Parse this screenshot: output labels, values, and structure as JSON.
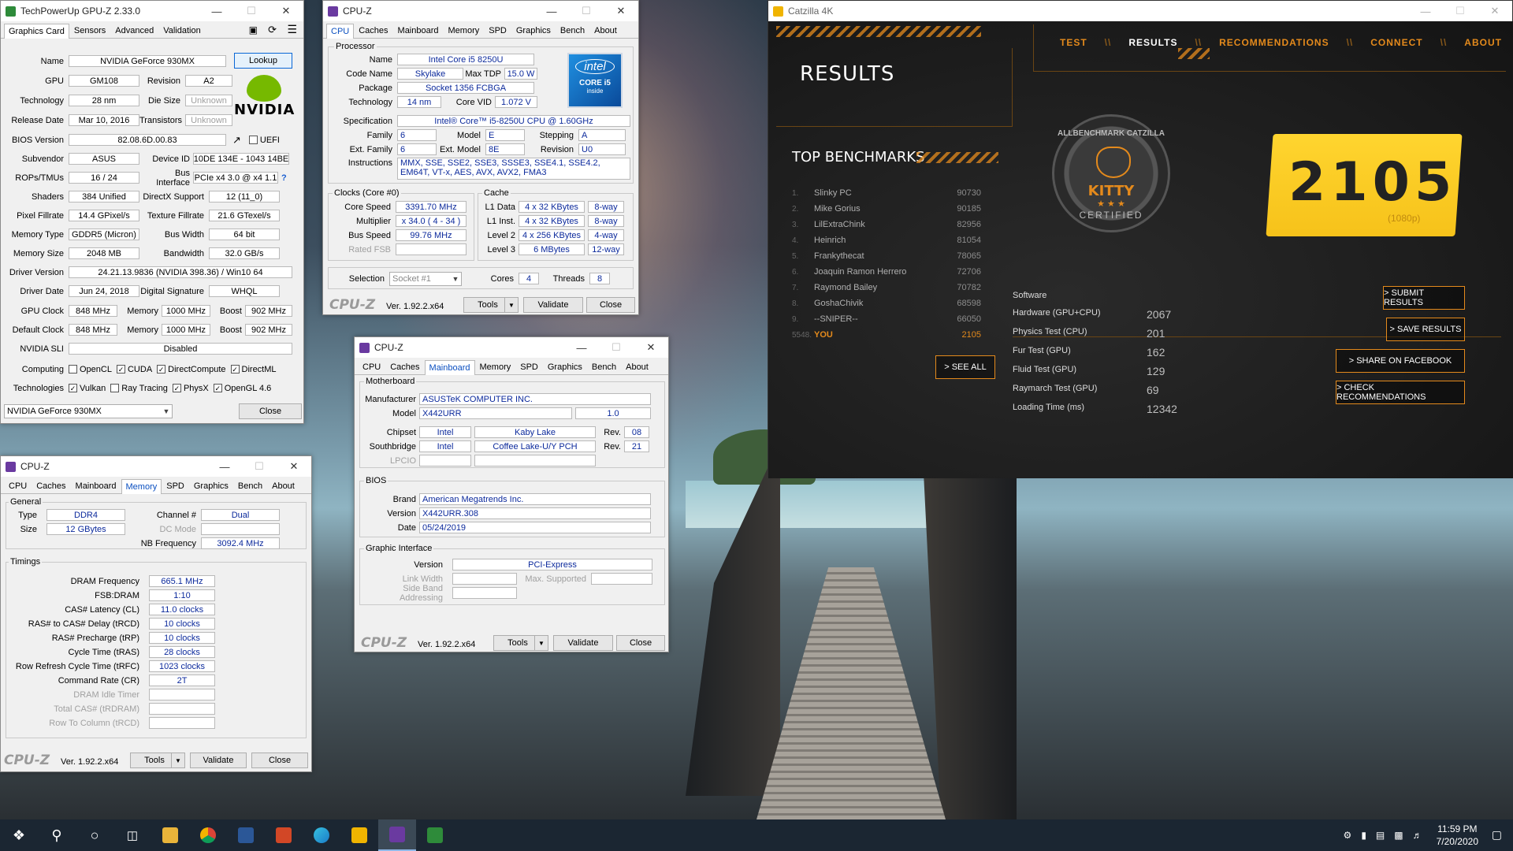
{
  "gpuz": {
    "title": "TechPowerUp GPU-Z 2.33.0",
    "tabs": [
      "Graphics Card",
      "Sensors",
      "Advanced",
      "Validation"
    ],
    "lookup": "Lookup",
    "name_l": "Name",
    "name": "NVIDIA GeForce 930MX",
    "gpu_l": "GPU",
    "gpu": "GM108",
    "rev_l": "Revision",
    "rev": "A2",
    "tech_l": "Technology",
    "tech": "28 nm",
    "die_l": "Die Size",
    "die": "Unknown",
    "rel_l": "Release Date",
    "rel": "Mar 10, 2016",
    "trans_l": "Transistors",
    "trans": "Unknown",
    "bios_l": "BIOS Version",
    "bios": "82.08.6D.00.83",
    "uefi": "UEFI",
    "sub_l": "Subvendor",
    "sub": "ASUS",
    "devid_l": "Device ID",
    "devid": "10DE 134E - 1043 14BE",
    "rops_l": "ROPs/TMUs",
    "rops": "16 / 24",
    "bus_l": "Bus Interface",
    "bus": "PCIe x4 3.0 @ x4 1.1",
    "shad_l": "Shaders",
    "shad": "384 Unified",
    "dx_l": "DirectX Support",
    "dx": "12 (11_0)",
    "pix_l": "Pixel Fillrate",
    "pix": "14.4 GPixel/s",
    "tex_l": "Texture Fillrate",
    "tex": "21.6 GTexel/s",
    "mtype_l": "Memory Type",
    "mtype": "GDDR5 (Micron)",
    "bw_l": "Bus Width",
    "bw": "64 bit",
    "msize_l": "Memory Size",
    "msize": "2048 MB",
    "band_l": "Bandwidth",
    "band": "32.0 GB/s",
    "drv_l": "Driver Version",
    "drv": "24.21.13.9836 (NVIDIA 398.36) / Win10 64",
    "ddate_l": "Driver Date",
    "ddate": "Jun 24, 2018",
    "dsig_l": "Digital Signature",
    "dsig": "WHQL",
    "gclk_l": "GPU Clock",
    "gclk": "848 MHz",
    "mem_l": "Memory",
    "memclk": "1000 MHz",
    "boost_l": "Boost",
    "boost": "902 MHz",
    "dclk_l": "Default Clock",
    "dclk": "848 MHz",
    "dmem": "1000 MHz",
    "dboost": "902 MHz",
    "sli_l": "NVIDIA SLI",
    "sli": "Disabled",
    "comp_l": "Computing",
    "comp": [
      "OpenCL",
      "CUDA",
      "DirectCompute",
      "DirectML"
    ],
    "techs_l": "Technologies",
    "techs": [
      "Vulkan",
      "Ray Tracing",
      "PhysX",
      "OpenGL 4.6"
    ],
    "select": "NVIDIA GeForce 930MX",
    "close": "Close",
    "logo": "NVIDIA"
  },
  "cpuz_cpu": {
    "title": "CPU-Z",
    "tabs": [
      "CPU",
      "Caches",
      "Mainboard",
      "Memory",
      "SPD",
      "Graphics",
      "Bench",
      "About"
    ],
    "proc": "Processor",
    "name_l": "Name",
    "name": "Intel Core i5 8250U",
    "code_l": "Code Name",
    "code": "Skylake",
    "tdp_l": "Max TDP",
    "tdp": "15.0 W",
    "pkg_l": "Package",
    "pkg": "Socket 1356 FCBGA",
    "tech_l": "Technology",
    "tech": "14 nm",
    "vid_l": "Core VID",
    "vid": "1.072 V",
    "spec_l": "Specification",
    "spec": "Intel® Core™ i5-8250U CPU @ 1.60GHz",
    "fam_l": "Family",
    "fam": "6",
    "model_l": "Model",
    "model": "E",
    "step_l": "Stepping",
    "step": "A",
    "efam_l": "Ext. Family",
    "efam": "6",
    "emod_l": "Ext. Model",
    "emod": "8E",
    "rev_l": "Revision",
    "rev": "U0",
    "instr_l": "Instructions",
    "instr": "MMX, SSE, SSE2, SSE3, SSSE3, SSE4.1, SSE4.2, EM64T, VT-x, AES, AVX, AVX2, FMA3",
    "clocks": "Clocks (Core #0)",
    "cache": "Cache",
    "cs_l": "Core Speed",
    "cs": "3391.70 MHz",
    "mul_l": "Multiplier",
    "mul": "x 34.0 ( 4 - 34 )",
    "bs_l": "Bus Speed",
    "bs": "99.76 MHz",
    "fsb_l": "Rated FSB",
    "l1d_l": "L1 Data",
    "l1d": "4 x 32 KBytes",
    "l1d_w": "8-way",
    "l1i_l": "L1 Inst.",
    "l1i": "4 x 32 KBytes",
    "l1i_w": "8-way",
    "l2_l": "Level 2",
    "l2": "4 x 256 KBytes",
    "l2_w": "4-way",
    "l3_l": "Level 3",
    "l3": "6 MBytes",
    "l3_w": "12-way",
    "sel_l": "Selection",
    "sel": "Socket #1",
    "cores_l": "Cores",
    "cores": "4",
    "thr_l": "Threads",
    "thr": "8",
    "intel_a": "intel",
    "intel_b": "CORE i5",
    "intel_c": "inside"
  },
  "cpuz_common": {
    "logo": "CPU-Z",
    "ver": "Ver. 1.92.2.x64",
    "tools": "Tools",
    "validate": "Validate",
    "close": "Close"
  },
  "cpuz_mb": {
    "title": "CPU-Z",
    "mb": "Motherboard",
    "man_l": "Manufacturer",
    "man": "ASUSTeK COMPUTER INC.",
    "model_l": "Model",
    "model": "X442URR",
    "model_rev": "1.0",
    "chip_l": "Chipset",
    "chip": "Intel",
    "chip2": "Kaby Lake",
    "crev_l": "Rev.",
    "crev": "08",
    "sb_l": "Southbridge",
    "sb": "Intel",
    "sb2": "Coffee Lake-U/Y PCH",
    "srev": "21",
    "lpc_l": "LPCIO",
    "bios": "BIOS",
    "brand_l": "Brand",
    "brand": "American Megatrends Inc.",
    "ver_l": "Version",
    "ver": "X442URR.308",
    "date_l": "Date",
    "date": "05/24/2019",
    "gi": "Graphic Interface",
    "gver_l": "Version",
    "gver": "PCI-Express",
    "lw_l": "Link Width",
    "ms_l": "Max. Supported",
    "sba_l": "Side Band Addressing"
  },
  "cpuz_mem": {
    "title": "CPU-Z",
    "general": "General",
    "type_l": "Type",
    "type": "DDR4",
    "ch_l": "Channel #",
    "ch": "Dual",
    "size_l": "Size",
    "size": "12 GBytes",
    "dc_l": "DC Mode",
    "nb_l": "NB Frequency",
    "nb": "3092.4 MHz",
    "timings": "Timings",
    "rows": [
      {
        "l": "DRAM Frequency",
        "v": "665.1 MHz",
        "d": false
      },
      {
        "l": "FSB:DRAM",
        "v": "1:10",
        "d": false
      },
      {
        "l": "CAS# Latency (CL)",
        "v": "11.0 clocks",
        "d": false
      },
      {
        "l": "RAS# to CAS# Delay (tRCD)",
        "v": "10 clocks",
        "d": false
      },
      {
        "l": "RAS# Precharge (tRP)",
        "v": "10 clocks",
        "d": false
      },
      {
        "l": "Cycle Time (tRAS)",
        "v": "28 clocks",
        "d": false
      },
      {
        "l": "Row Refresh Cycle Time (tRFC)",
        "v": "1023 clocks",
        "d": false
      },
      {
        "l": "Command Rate (CR)",
        "v": "2T",
        "d": false
      },
      {
        "l": "DRAM Idle Timer",
        "v": "",
        "d": true
      },
      {
        "l": "Total CAS# (tRDRAM)",
        "v": "",
        "d": true
      },
      {
        "l": "Row To Column (tRCD)",
        "v": "",
        "d": true
      }
    ]
  },
  "catzilla": {
    "title": "Catzilla 4K",
    "nav": [
      "TEST",
      "RESULTS",
      "RECOMMENDATIONS",
      "CONNECT",
      "ABOUT"
    ],
    "sep": "\\\\",
    "heading": "RESULTS",
    "top": "TOP BENCHMARKS",
    "bench": [
      {
        "r": "1.",
        "n": "Slinky PC",
        "s": "90730"
      },
      {
        "r": "2.",
        "n": "Mike Gorius",
        "s": "90185"
      },
      {
        "r": "3.",
        "n": "LilExtraChink",
        "s": "82956"
      },
      {
        "r": "4.",
        "n": "Heinrich",
        "s": "81054"
      },
      {
        "r": "5.",
        "n": "Frankythecat",
        "s": "78065"
      },
      {
        "r": "6.",
        "n": "Joaquin Ramon Herrero",
        "s": "72706"
      },
      {
        "r": "7.",
        "n": "Raymond Bailey",
        "s": "70782"
      },
      {
        "r": "8.",
        "n": "GoshaChivik",
        "s": "68598"
      },
      {
        "r": "9.",
        "n": "--SNIPER--",
        "s": "66050"
      }
    ],
    "you": {
      "r": "5548.",
      "n": "YOU",
      "s": "2105"
    },
    "see_all": "> SEE ALL",
    "score": "2105",
    "score_sub": "(1080p)",
    "medal_top": "ALLBENCHMARK CATZILLA",
    "medal_mid": "KITTY",
    "medal_bot": "CERTIFIED",
    "medal_stars": "★ ★ ★",
    "sw": "Software",
    "results": [
      {
        "l": "Hardware (GPU+CPU)",
        "v": "2067"
      },
      {
        "l": "Physics Test (CPU)",
        "v": "201"
      },
      {
        "l": "Fur Test (GPU)",
        "v": "162"
      },
      {
        "l": "Fluid Test (GPU)",
        "v": "129"
      },
      {
        "l": "Raymarch Test (GPU)",
        "v": "69"
      },
      {
        "l": "Loading Time (ms)",
        "v": "12342"
      }
    ],
    "btns": [
      "> SUBMIT RESULTS",
      "> SAVE RESULTS",
      "> SHARE ON FACEBOOK",
      "> CHECK RECOMMENDATIONS"
    ]
  },
  "taskbar": {
    "time": "11:59 PM",
    "date": "7/20/2020"
  },
  "colors": {
    "accent": "#e48a1c",
    "cpuz_value": "#0c2a9c",
    "score_bg": "#ffd52f"
  }
}
